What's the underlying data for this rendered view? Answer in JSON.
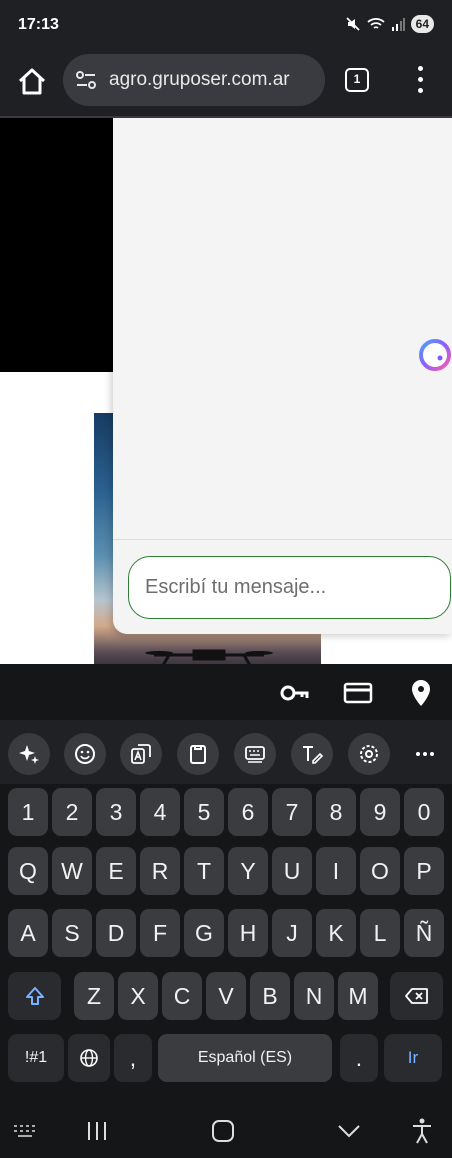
{
  "status": {
    "time": "17:13",
    "battery": "64"
  },
  "browser": {
    "url": "agro.gruposer.com.ar",
    "tab_count": "1"
  },
  "chat": {
    "input_placeholder": "Escribí tu mensaje...",
    "accent_color": "#2e7d32"
  },
  "keyboard": {
    "numbers": [
      "1",
      "2",
      "3",
      "4",
      "5",
      "6",
      "7",
      "8",
      "9",
      "0"
    ],
    "row1": [
      "Q",
      "W",
      "E",
      "R",
      "T",
      "Y",
      "U",
      "I",
      "O",
      "P"
    ],
    "row2": [
      "A",
      "S",
      "D",
      "F",
      "G",
      "H",
      "J",
      "K",
      "L",
      "Ñ"
    ],
    "row3": [
      "Z",
      "X",
      "C",
      "V",
      "B",
      "N",
      "M"
    ],
    "symbols_label": "!#1",
    "comma_label": ",",
    "space_label": "Español (ES)",
    "period_label": ".",
    "enter_label": "Ir",
    "toolbar_icons": [
      "ai-sparkle-icon",
      "emoji-icon",
      "translate-icon",
      "clipboard-icon",
      "keyboard-mode-icon",
      "handwriting-icon",
      "settings-icon",
      "more-icon"
    ],
    "autofill_icons": [
      "key-icon",
      "card-icon",
      "location-icon"
    ]
  }
}
